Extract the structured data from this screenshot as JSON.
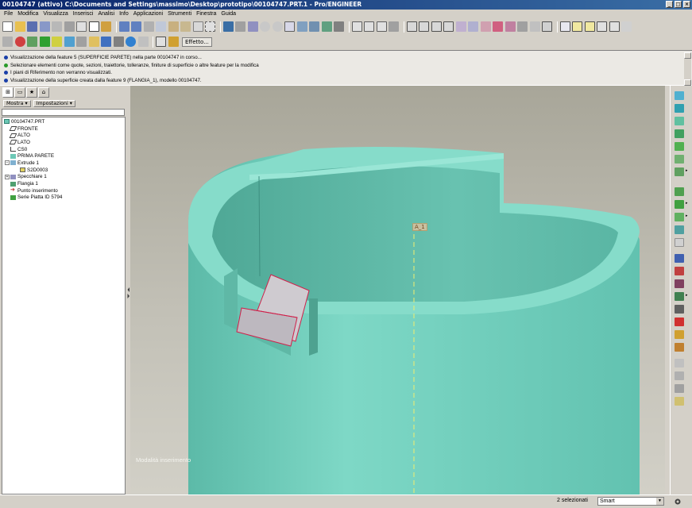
{
  "window": {
    "title": "00104747 (attivo) C:\\Documents and Settings\\massimo\\Desktop\\prototipo\\00104747.PRT.1 - Pro/ENGINEER"
  },
  "menubar": {
    "items": [
      "File",
      "Modifica",
      "Visualizza",
      "Inserisci",
      "Analisi",
      "Info",
      "Applicazioni",
      "Strumenti",
      "Finestra",
      "Guida"
    ]
  },
  "toolbar": {
    "effetto_label": "Effetto..."
  },
  "messages": [
    {
      "icon": "info-dot",
      "text": "Visualizzazione della feature 5 (SUPERFICIE PARETE) nella parte 00104747 in corso..."
    },
    {
      "icon": "prompt-arrow",
      "text": "Selezionare elementi come quote, sezioni, traiettorie, tolleranze, finiture di superficie o altre feature per la modifica"
    },
    {
      "icon": "info-dot",
      "text": "I piani di Riferimento non verranno visualizzati."
    },
    {
      "icon": "info-dot",
      "text": "Visualizzazione della superficie creata dalla feature 9 (FLANGIA_1), modello 00104747."
    }
  ],
  "model_tree": {
    "menus": [
      "Mostra",
      "Impostazioni"
    ],
    "root": "00104747.PRT",
    "items": [
      {
        "label": "FRONTE",
        "level": 1,
        "type": "datum-plane"
      },
      {
        "label": "ALTO",
        "level": 1,
        "type": "datum-plane"
      },
      {
        "label": "LATO",
        "level": 1,
        "type": "datum-plane"
      },
      {
        "label": "CS0",
        "level": 1,
        "type": "csys"
      },
      {
        "label": "PRIMA PARETE",
        "level": 1,
        "type": "wall"
      },
      {
        "label": "Extrude 1",
        "level": 1,
        "type": "extrude",
        "expanded": true
      },
      {
        "label": "S2D0003",
        "level": 2,
        "type": "sketch"
      },
      {
        "label": "Specchiare 1",
        "level": 1,
        "type": "mirror",
        "expandable": true
      },
      {
        "label": "Flangia 1",
        "level": 1,
        "type": "flange"
      },
      {
        "label": "Punto inserimento",
        "level": 1,
        "type": "insert-point"
      },
      {
        "label": "Serie Piatta ID 5794",
        "level": 1,
        "type": "flat-pattern"
      }
    ]
  },
  "graphics": {
    "axis_label": "A_1",
    "mode_label": "Modalità inserimento",
    "colors": {
      "part": "#6cc8b6",
      "background_top": "#a8a699",
      "selected_face": "#cfcbd0",
      "highlight_edge": "#d0204a",
      "axis": "#f0ee70"
    }
  },
  "status": {
    "selected": "2 selezionati",
    "filter": "Smart"
  }
}
